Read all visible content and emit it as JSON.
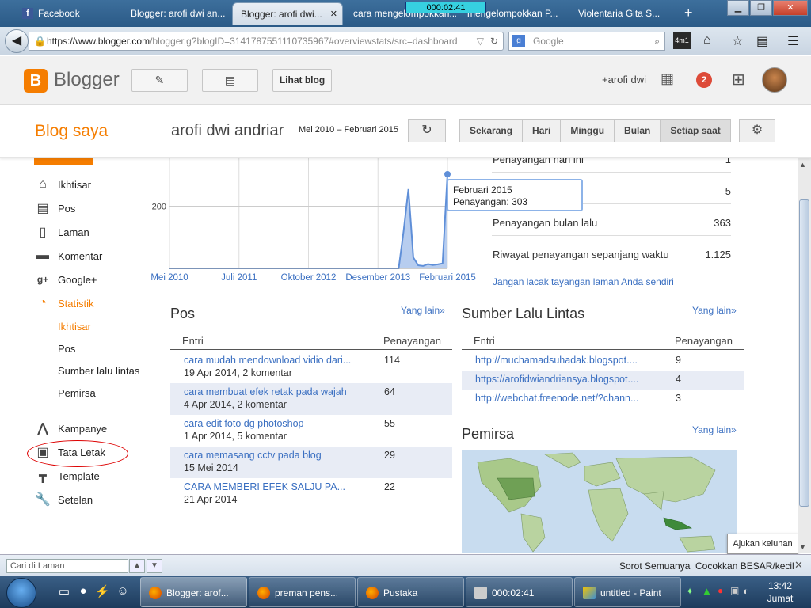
{
  "browser": {
    "tabs": [
      {
        "label": "Facebook",
        "active": false
      },
      {
        "label": "Blogger: arofi dwi an...",
        "active": false
      },
      {
        "label": "Blogger: arofi dwi...",
        "active": true
      },
      {
        "label": "cara mengelompokkan...",
        "active": false
      },
      {
        "label": "mengelompokkan P...",
        "active": false
      },
      {
        "label": "Violentaria Gita S...",
        "active": false
      }
    ],
    "timer_overlay": "000:02:41",
    "url_domain": "https://www.blogger.com",
    "url_path": "/blogger.g?blogID=3141787551110735967#overviewstats/src=dashboard",
    "search_placeholder": "Google",
    "counter": "4m1"
  },
  "blogger_header": {
    "logo_letter": "B",
    "brand": "Blogger",
    "view_blog_label": "Lihat blog",
    "user": "+arofi dwi",
    "notifications": "2"
  },
  "subheader": {
    "my_blogs": "Blog saya",
    "blog_title": "arofi dwi andriar",
    "date_range": "Mei 2010 – Februari 2015",
    "periods": [
      "Sekarang",
      "Hari",
      "Minggu",
      "Bulan",
      "Setiap saat"
    ]
  },
  "sidebar": {
    "items": [
      {
        "label": "Ikhtisar",
        "icon": "home-icon"
      },
      {
        "label": "Pos",
        "icon": "posts-icon"
      },
      {
        "label": "Laman",
        "icon": "pages-icon"
      },
      {
        "label": "Komentar",
        "icon": "comment-icon"
      },
      {
        "label": "Google+",
        "icon": "googleplus-icon"
      },
      {
        "label": "Statistik",
        "icon": "pie-chart-icon"
      }
    ],
    "stats_sub": [
      "Ikhtisar",
      "Pos",
      "Sumber lalu lintas",
      "Pemirsa"
    ],
    "items2": [
      {
        "label": "Kampanye",
        "icon": "campaign-icon"
      },
      {
        "label": "Tata Letak",
        "icon": "layout-icon"
      },
      {
        "label": "Template",
        "icon": "paint-roller-icon"
      },
      {
        "label": "Setelan",
        "icon": "wrench-icon"
      }
    ]
  },
  "chart_data": {
    "type": "area",
    "title": "",
    "ytick_labels": [
      "200"
    ],
    "xtick_labels": [
      "Mei 2010",
      "Juli 2011",
      "Oktober 2012",
      "Desember 2013",
      "Februari 2015"
    ],
    "series": [
      {
        "values": [
          0,
          0,
          0,
          0,
          0,
          0,
          0,
          0,
          0,
          0,
          0,
          0,
          0,
          0,
          0,
          0,
          0,
          0,
          0,
          0,
          0,
          0,
          0,
          0,
          0,
          0,
          0,
          0,
          0,
          0,
          0,
          0,
          0,
          0,
          0,
          0,
          0,
          0,
          0,
          0,
          0,
          0,
          0,
          0,
          0,
          0,
          0,
          0,
          120,
          255,
          35,
          10,
          8,
          14,
          11,
          13,
          16,
          303
        ]
      }
    ],
    "ylim": [
      0,
      303
    ],
    "color": "#5f8fd8",
    "tooltip": {
      "title": "Februari 2015",
      "label": "Penayangan: 303"
    }
  },
  "stats_summary": {
    "rows": [
      {
        "label": "Penayangan hari ini",
        "value": "1"
      },
      {
        "label": "",
        "value": "5"
      },
      {
        "label": "Penayangan bulan lalu",
        "value": "363"
      },
      {
        "label": "Riwayat penayangan sepanjang waktu",
        "value": "1.125"
      }
    ],
    "dont_track": "Jangan lacak tayangan laman Anda sendiri"
  },
  "posts": {
    "title": "Pos",
    "more": "Yang lain»",
    "col_entry": "Entri",
    "col_views": "Penayangan",
    "rows": [
      {
        "title": "cara mudah mendownload vidio dari...",
        "date": "19 Apr 2014, 2 komentar",
        "views": "114"
      },
      {
        "title": "cara membuat efek retak pada wajah",
        "date": "4 Apr 2014, 2 komentar",
        "views": "64"
      },
      {
        "title": "cara edit foto dg photoshop",
        "date": "1 Apr 2014, 5 komentar",
        "views": "55"
      },
      {
        "title": "cara memasang cctv pada blog",
        "date": "15 Mei 2014",
        "views": "29"
      },
      {
        "title": "CARA MEMBERI EFEK SALJU PA...",
        "date": "21 Apr 2014",
        "views": "22"
      }
    ]
  },
  "traffic": {
    "title": "Sumber Lalu Lintas",
    "more": "Yang lain»",
    "col_entry": "Entri",
    "col_views": "Penayangan",
    "rows": [
      {
        "url": "http://muchamadsuhadak.blogspot....",
        "views": "9"
      },
      {
        "url": "https://arofidwiandriansya.blogspot....",
        "views": "4"
      },
      {
        "url": "http://webchat.freenode.net/?chann...",
        "views": "3"
      }
    ]
  },
  "audience": {
    "title": "Pemirsa",
    "more": "Yang lain»"
  },
  "feedback": "Ajukan keluhan",
  "findbar": {
    "placeholder": "Cari di Laman",
    "highlight_all": "Sorot Semuanya",
    "match_case": "Cocokkan BESAR/kecil"
  },
  "taskbar": {
    "tasks": [
      "Blogger: arof...",
      "preman pens...",
      "Pustaka",
      "000:02:41",
      "untitled - Paint"
    ],
    "time": "13:42",
    "day": "Jumat"
  }
}
